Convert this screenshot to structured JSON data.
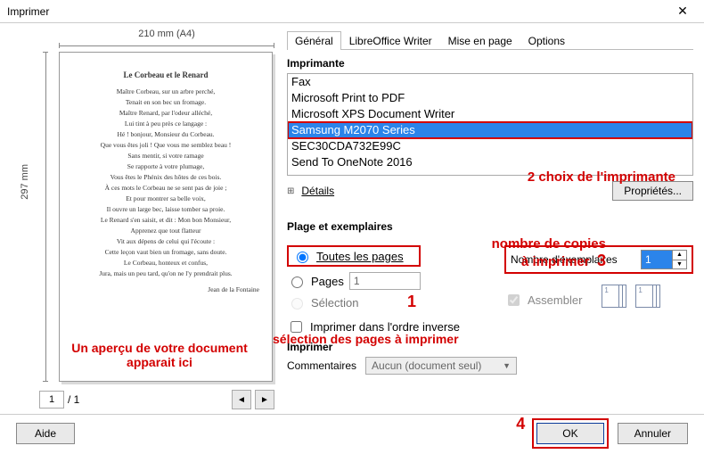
{
  "window": {
    "title": "Imprimer",
    "close_glyph": "✕"
  },
  "ruler": {
    "top": "210 mm (A4)",
    "left": "297 mm"
  },
  "preview_poem": {
    "title": "Le Corbeau et le Renard",
    "lines": [
      "Maître Corbeau, sur un arbre perché,",
      "Tenait en son bec un fromage.",
      "Maître Renard, par l'odeur alléché,",
      "Lui tint à peu près ce langage :",
      "Hé ! bonjour, Monsieur du Corbeau.",
      "Que vous êtes joli ! Que vous me semblez beau !",
      "Sans mentir, si votre ramage",
      "Se rapporte à votre plumage,",
      "Vous êtes le Phénix des hôtes de ces bois.",
      "À ces mots le Corbeau ne se sent pas de joie ;",
      "Et pour montrer sa belle voix,",
      "Il ouvre un large bec, laisse tomber sa proie.",
      "Le Renard s'en saisit, et dit : Mon bon Monsieur,",
      "Apprenez que tout flatteur",
      "Vit aux dépens de celui qui l'écoute :",
      "Cette leçon vaut bien un fromage, sans doute.",
      "Le Corbeau, honteux et confus,",
      "Jura, mais un peu tard, qu'on ne l'y prendrait plus."
    ],
    "signature": "Jean de la Fontaine"
  },
  "annot": {
    "preview1": "Un aperçu de votre document",
    "preview2": "apparait ici",
    "printer_choice": "2 choix de l'imprimante",
    "copies1": "nombre de copies",
    "copies2": "à imprimer",
    "copies_num": "3",
    "range_num": "1",
    "range_sel": "sélection des pages à imprimer",
    "ok_num": "4"
  },
  "pager": {
    "current": "1",
    "total": "/ 1"
  },
  "tabs": [
    "Général",
    "LibreOffice Writer",
    "Mise en page",
    "Options"
  ],
  "sections": {
    "imprimante": "Imprimante",
    "plage": "Plage et exemplaires",
    "imprimer": "Imprimer"
  },
  "printers": [
    "Fax",
    "Microsoft Print to PDF",
    "Microsoft XPS Document Writer",
    "Samsung M2070 Series",
    "SEC30CDA732E99C",
    "Send To OneNote 2016"
  ],
  "printers_selected_index": 3,
  "details": {
    "label": "Détails",
    "properties": "Propriétés..."
  },
  "range": {
    "all": "Toutes les pages",
    "pages": "Pages",
    "pages_value": "1",
    "selection": "Sélection",
    "reverse": "Imprimer dans l'ordre inverse"
  },
  "copies": {
    "label": "Nombre d'exemplaires",
    "value": "1",
    "collate": "Assembler"
  },
  "comments": {
    "label": "Commentaires",
    "value": "Aucun (document seul)"
  },
  "footer": {
    "help": "Aide",
    "ok": "OK",
    "cancel": "Annuler"
  }
}
